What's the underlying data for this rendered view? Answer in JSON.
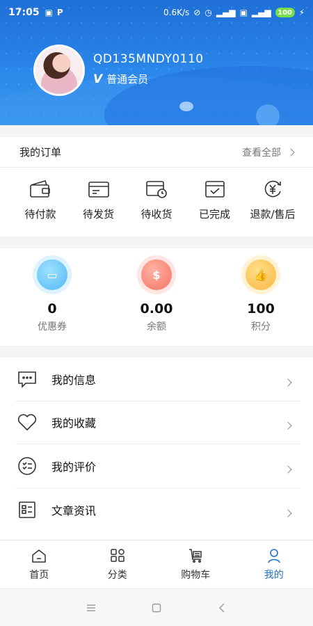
{
  "status_bar": {
    "time": "17:05",
    "net_speed": "0.6K/s",
    "battery": "100"
  },
  "profile": {
    "username": "QD135MNDY0110",
    "member_badge": "V",
    "member_level": "普通会员"
  },
  "orders": {
    "title": "我的订单",
    "view_all": "查看全部",
    "items": [
      {
        "label": "待付款",
        "icon": "wallet-icon"
      },
      {
        "label": "待发货",
        "icon": "box-icon"
      },
      {
        "label": "待收货",
        "icon": "delivery-clock-icon"
      },
      {
        "label": "已完成",
        "icon": "check-box-icon"
      },
      {
        "label": "退款/售后",
        "icon": "yuan-refund-icon"
      }
    ]
  },
  "assets": [
    {
      "value": "0",
      "label": "优惠券",
      "icon": "coupon-icon",
      "color": "#2aa7f2"
    },
    {
      "value": "0.00",
      "label": "余额",
      "icon": "money-bag-icon",
      "color": "#f04e3e"
    },
    {
      "value": "100",
      "label": "积分",
      "icon": "thumbs-up-icon",
      "color": "#f7a21b"
    }
  ],
  "menu": [
    {
      "label": "我的信息",
      "icon": "message-icon"
    },
    {
      "label": "我的收藏",
      "icon": "heart-icon"
    },
    {
      "label": "我的评价",
      "icon": "review-icon"
    },
    {
      "label": "文章资讯",
      "icon": "article-icon"
    }
  ],
  "tabbar": [
    {
      "label": "首页",
      "icon": "home-icon",
      "active": false
    },
    {
      "label": "分类",
      "icon": "category-icon",
      "active": false
    },
    {
      "label": "购物车",
      "icon": "cart-icon",
      "active": false
    },
    {
      "label": "我的",
      "icon": "user-icon",
      "active": true
    }
  ],
  "colors": {
    "header_blue": "#2a86e8",
    "active_tab": "#1e73c9"
  }
}
